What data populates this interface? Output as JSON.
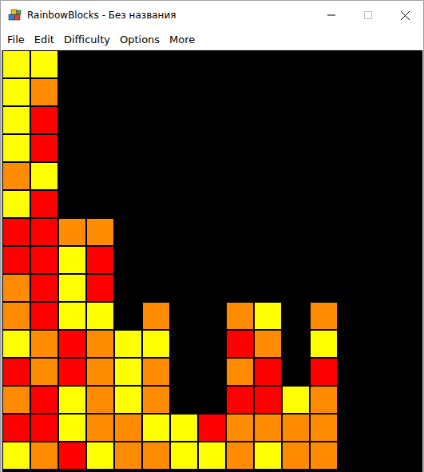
{
  "window": {
    "title": "RainbowBlocks - Без названия"
  },
  "menu": [
    "File",
    "Edit",
    "Difficulty",
    "Options",
    "More"
  ],
  "board": {
    "rows": [
      [
        "#ffff00",
        "#ffff00",
        null,
        null,
        null,
        null,
        null,
        null,
        null,
        null,
        null,
        null,
        null,
        null,
        null
      ],
      [
        "#ffff00",
        "#ff8c00",
        null,
        null,
        null,
        null,
        null,
        null,
        null,
        null,
        null,
        null,
        null,
        null,
        null
      ],
      [
        "#ffff00",
        "#ff0000",
        null,
        null,
        null,
        null,
        null,
        null,
        null,
        null,
        null,
        null,
        null,
        null,
        null
      ],
      [
        "#ffff00",
        "#ff0000",
        null,
        null,
        null,
        null,
        null,
        null,
        null,
        null,
        null,
        null,
        null,
        null,
        null
      ],
      [
        "#ff8c00",
        "#ffff00",
        null,
        null,
        null,
        null,
        null,
        null,
        null,
        null,
        null,
        null,
        null,
        null,
        null
      ],
      [
        "#ffff00",
        "#ff0000",
        null,
        null,
        null,
        null,
        null,
        null,
        null,
        null,
        null,
        null,
        null,
        null,
        null
      ],
      [
        "#ff0000",
        "#ff0000",
        "#ff8c00",
        "#ff8c00",
        null,
        null,
        null,
        null,
        null,
        null,
        null,
        null,
        null,
        null,
        null
      ],
      [
        "#ff0000",
        "#ff0000",
        "#ffff00",
        "#ff0000",
        null,
        null,
        null,
        null,
        null,
        null,
        null,
        null,
        null,
        null,
        null
      ],
      [
        "#ff8c00",
        "#ff0000",
        "#ffff00",
        "#ff0000",
        null,
        null,
        null,
        null,
        null,
        null,
        null,
        null,
        null,
        null,
        null
      ],
      [
        "#ff8c00",
        "#ff0000",
        "#ffff00",
        "#ffff00",
        null,
        "#ff8c00",
        null,
        null,
        "#ff8c00",
        "#ffff00",
        null,
        "#ff8c00",
        null,
        null,
        null
      ],
      [
        "#ffff00",
        "#ff8c00",
        "#ff0000",
        "#ff8c00",
        "#ffff00",
        "#ffff00",
        null,
        null,
        "#ff0000",
        "#ff8c00",
        null,
        "#ffff00",
        null,
        null,
        null
      ],
      [
        "#ff0000",
        "#ff8c00",
        "#ff0000",
        "#ff8c00",
        "#ffff00",
        "#ff8c00",
        null,
        null,
        "#ff8c00",
        "#ff0000",
        null,
        "#ff0000",
        null,
        null,
        null
      ],
      [
        "#ff8c00",
        "#ff0000",
        "#ffff00",
        "#ff8c00",
        "#ffff00",
        "#ff8c00",
        null,
        null,
        "#ff0000",
        "#ff0000",
        "#ffff00",
        "#ff8c00",
        null,
        null,
        null
      ],
      [
        "#ff0000",
        "#ff0000",
        "#ffff00",
        "#ff8c00",
        "#ff8c00",
        "#ffff00",
        "#ffff00",
        "#ff0000",
        "#ff8c00",
        "#ff8c00",
        "#ff8c00",
        "#ff8c00",
        null,
        null,
        null
      ],
      [
        "#ffff00",
        "#ff8c00",
        "#ff0000",
        "#ffff00",
        "#ff8c00",
        "#ff8c00",
        "#ffff00",
        "#ffff00",
        "#ff8c00",
        "#ffff00",
        "#ff8c00",
        "#ff8c00",
        null,
        null,
        null
      ]
    ]
  }
}
